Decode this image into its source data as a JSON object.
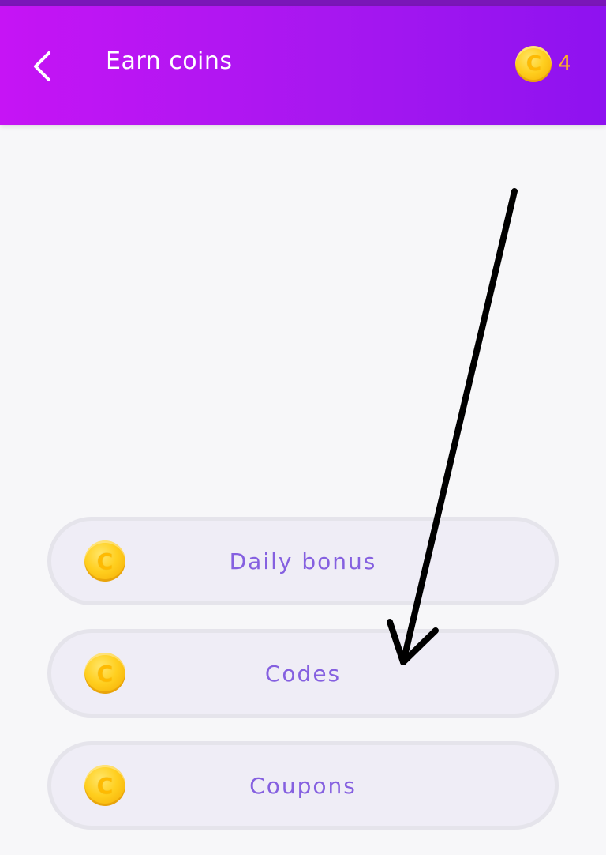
{
  "header": {
    "title": "Earn coins",
    "back_icon": "chevron-left-icon",
    "coin_icon": "coin-icon",
    "coin_balance": "4",
    "gradient_colors": [
      "#c614f5",
      "#8e12f0"
    ]
  },
  "menu": {
    "items": [
      {
        "label": "Daily bonus",
        "icon": "coin-icon"
      },
      {
        "label": "Codes",
        "icon": "coin-icon"
      },
      {
        "label": "Coupons",
        "icon": "coin-icon"
      }
    ]
  },
  "colors": {
    "label_purple": "#8560e0",
    "balance_orange": "#ffb422",
    "row_bg": "#efedf6",
    "arrow": "#000000"
  },
  "coin_glyph": "C"
}
